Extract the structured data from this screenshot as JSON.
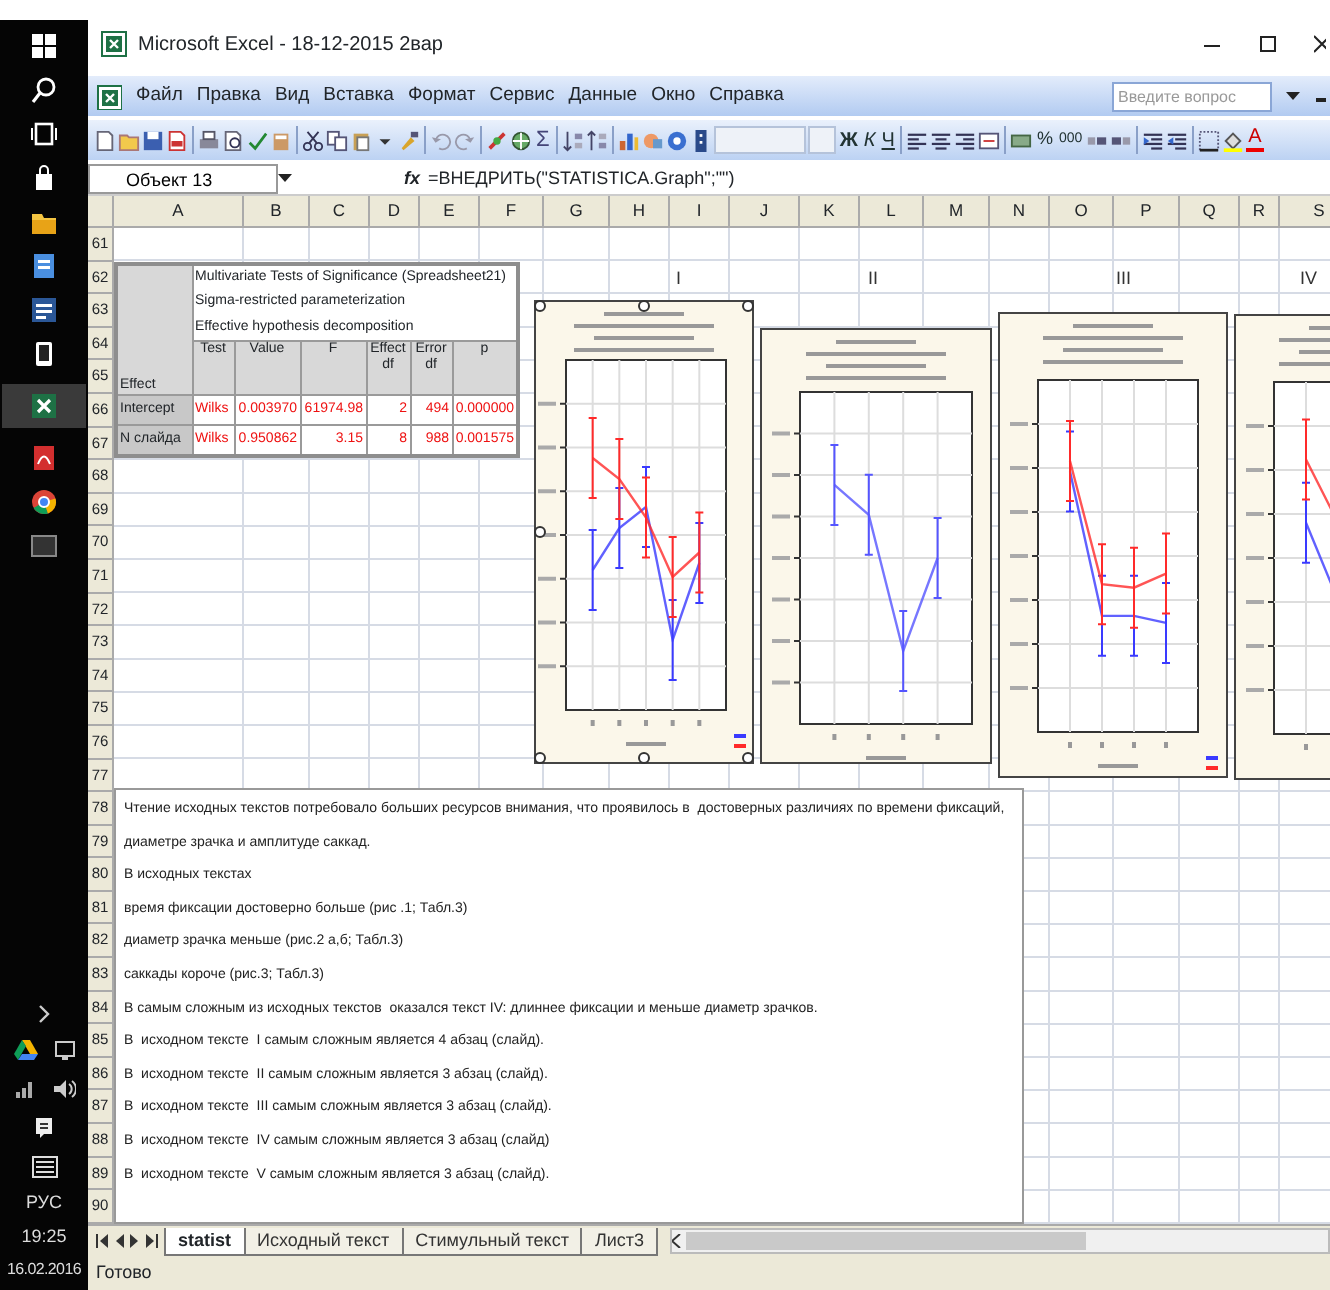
{
  "taskbar": {
    "language": "РУС",
    "time": "19:25",
    "date": "16.02.2016"
  },
  "window": {
    "title": "Microsoft Excel - 18-12-2015 2вар"
  },
  "menu": [
    "Файл",
    "Правка",
    "Вид",
    "Вставка",
    "Формат",
    "Сервис",
    "Данные",
    "Окно",
    "Справка"
  ],
  "help_search": {
    "placeholder": "Введите вопрос"
  },
  "toolbar": {
    "autosum": "Σ",
    "bold": "Ж",
    "italic": "К",
    "underline": "Ч",
    "percent": "%",
    "thousands": "000",
    "font_color": "A"
  },
  "formula_bar": {
    "name_box": "Объект 13",
    "function_button": "fx",
    "formula": "=ВНЕДРИТЬ(\"STATISTICA.Graph\";\"\")"
  },
  "columns": [
    "A",
    "B",
    "C",
    "D",
    "E",
    "F",
    "G",
    "H",
    "I",
    "J",
    "K",
    "L",
    "M",
    "N",
    "O",
    "P",
    "Q",
    "R",
    "S"
  ],
  "rows": [
    "61",
    "62",
    "63",
    "64",
    "65",
    "66",
    "67",
    "68",
    "69",
    "70",
    "71",
    "72",
    "73",
    "74",
    "75",
    "76",
    "77",
    "78",
    "79",
    "80",
    "81",
    "82",
    "83",
    "84",
    "85",
    "86",
    "87",
    "88",
    "89",
    "90"
  ],
  "stats_table": {
    "title_lines": [
      "Multivariate Tests of Significance (Spreadsheet21)",
      "Sigma-restricted parameterization",
      "Effective hypothesis decomposition"
    ],
    "headers": [
      "Effect",
      "Test",
      "Value",
      "F",
      "Effect df",
      "Error df",
      "p"
    ],
    "rows": [
      {
        "cells": [
          "Intercept",
          "Wilks",
          "0.003970",
          "61974.98",
          "2",
          "494",
          "0.000000"
        ]
      },
      {
        "cells": [
          "N слайда",
          "Wilks",
          "0.950862",
          "3.15",
          "8",
          "988",
          "0.001575"
        ]
      }
    ]
  },
  "chart_labels": [
    "I",
    "II",
    "III",
    "IV"
  ],
  "text_lines": [
    "Чтение исходных текстов потребовало больших ресурсов внимания, что проявилось в  достоверных различиях по времени фиксаций,",
    "диаметре зрачка и амплитуде саккад.",
    "В исходных текстах",
    "время фиксации достоверно больше (рис .1; Табл.3)",
    "диаметр зрачка меньше (рис.2 а,б; Табл.3)",
    "саккады короче (рис.3; Табл.3)",
    "В самым сложным из исходных текстов  оказался текст IV: длиннее фиксации и меньше диаметр зрачков.",
    "В  исходном тексте  I самым сложным является 4 абзац (слайд).",
    "В  исходном тексте  II самым сложным является 3 абзац (слайд).",
    "В  исходном тексте  III самым сложным является 3 абзац (слайд).",
    "В  исходном тексте  IV самым сложным является 3 абзац (слайд)",
    "В  исходном тексте  V самым сложным является 3 абзац (слайд)."
  ],
  "sheet_tabs": [
    {
      "label": "statist",
      "selected": true
    },
    {
      "label": "Исходный текст",
      "selected": false
    },
    {
      "label": "Стимульный текст",
      "selected": false
    },
    {
      "label": "Лист3",
      "selected": false
    }
  ],
  "status": "Готово"
}
